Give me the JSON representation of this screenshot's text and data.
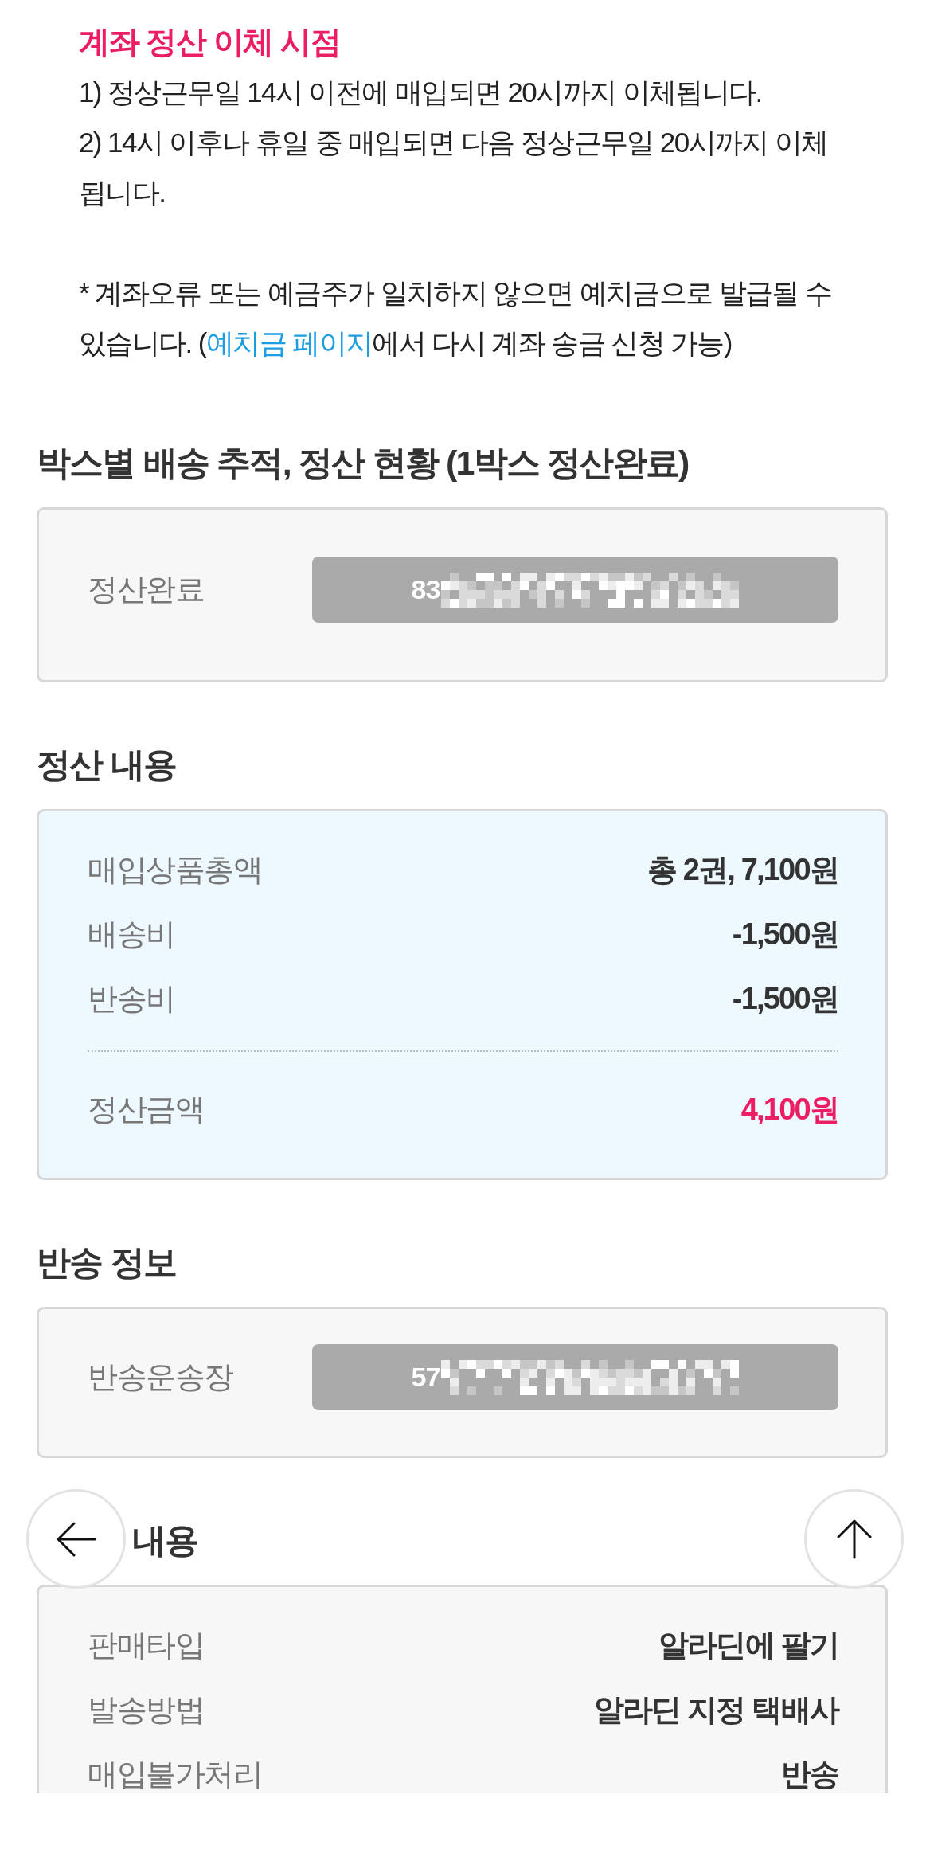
{
  "notice": {
    "title": "계좌 정산 이체 시점",
    "lines": [
      "1) 정상근무일 14시 이전에 매입되면 20시까지 이체됩니다.",
      "2) 14시 이후나 휴일 중 매입되면 다음 정상근무일 20시까지 이체 됩니다."
    ],
    "note": {
      "before": "* 계좌오류 또는 예금주가 일치하지 않으면 예치금으로 발급될 수 있습니다. (",
      "link": "예치금 페이지",
      "after": "에서 다시 계좌 송금 신청 가능)"
    }
  },
  "sections": [
    {
      "kind": "panel",
      "heading": "박스별 배송 추적, 정산 현황 (1박스 정산완료)",
      "rows": [
        {
          "kind": "tracking",
          "label": "정산완료",
          "value": "83"
        }
      ]
    },
    {
      "kind": "summary",
      "heading": "정산 내용",
      "rows": [
        {
          "kind": "item",
          "label": "매입상품총액",
          "value": "총 2권, 7,100원"
        },
        {
          "kind": "item",
          "label": "배송비",
          "value": "-1,500원"
        },
        {
          "kind": "item",
          "label": "반송비",
          "value": "-1,500원"
        },
        {
          "kind": "total",
          "label": "정산금액",
          "value": "4,100원"
        }
      ]
    },
    {
      "kind": "panel",
      "heading": "반송 정보",
      "rows": [
        {
          "kind": "tracking",
          "label": "반송운송장",
          "value": "57"
        }
      ]
    },
    {
      "kind": "panel",
      "heading": "내용",
      "rows": [
        {
          "kind": "item",
          "label": "판매타입",
          "value": "알라딘에 팔기"
        },
        {
          "kind": "item",
          "label": "발송방법",
          "value": "알라딘 지정 택배사"
        },
        {
          "kind": "item",
          "label": "매입불가처리",
          "value": "반송"
        }
      ]
    }
  ]
}
